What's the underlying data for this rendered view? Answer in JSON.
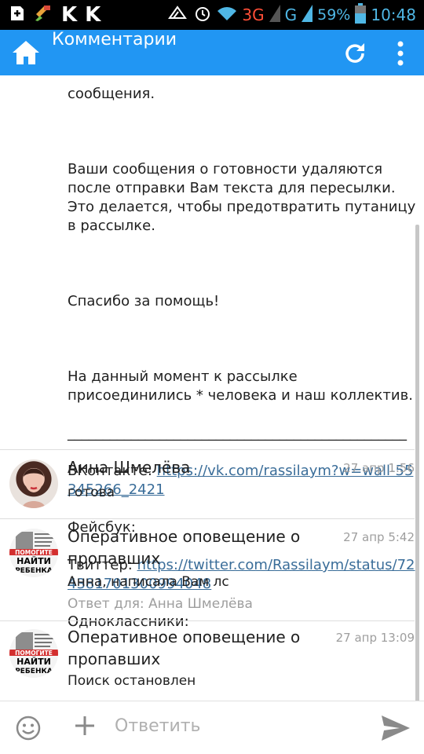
{
  "status_bar": {
    "network_3g": "3G",
    "network_g": "G",
    "battery": "59%",
    "time": "10:48",
    "icons": [
      "add-icon",
      "cleaner-icon",
      "vk-app-icon",
      "vk-app-icon",
      "sync-icon",
      "alarm-icon",
      "wifi-icon",
      "signal-icon",
      "signal-icon",
      "battery-icon"
    ]
  },
  "app_bar": {
    "title": "Комментарии",
    "color": "#2196f3"
  },
  "post": {
    "line_top": "сообщения.",
    "para1": "Ваши сообщения о готовности удаляются после отправки Вам текста для пересылки. Это делается, чтобы предотвратить путаницу в рассылке.",
    "para2": "Спасибо за помощь!",
    "para3": "На данный момент к рассылке присоединились * человека и наш коллектив.",
    "separator": "________________________________________________",
    "vk_label": "ВКонтакте: ",
    "vk_link": "https://vk.com/rassilaym?w=wall-55345266_2421",
    "facebook_label": "Фейсбук:",
    "twitter_label": "Твиттер: ",
    "twitter_link": "https://twitter.com/Rassilaym/status/724381701300994048",
    "ok_label": "Одноклассники:"
  },
  "comments": [
    {
      "author": "Анна Шмелёва",
      "date": "27 апр 1:56",
      "text": "готова",
      "reply_to": ""
    },
    {
      "author": "Оперативное оповещение о пропавших",
      "date": "27 апр 5:42",
      "text": "Анна, написала Вам лс",
      "reply_to": "Ответ для: Анна Шмелёва",
      "avatar_text": [
        "ПОМОГИТЕ",
        "НАЙТИ",
        "РЕБЕНКА"
      ]
    },
    {
      "author": "Оперативное оповещение о пропавших",
      "date": "27 апр 13:09",
      "text": "Поиск остановлен",
      "reply_to": "",
      "avatar_text": [
        "ПОМОГИТЕ",
        "НАЙТИ",
        "РЕБЕНКА"
      ]
    }
  ],
  "input_bar": {
    "placeholder": "Ответить"
  }
}
